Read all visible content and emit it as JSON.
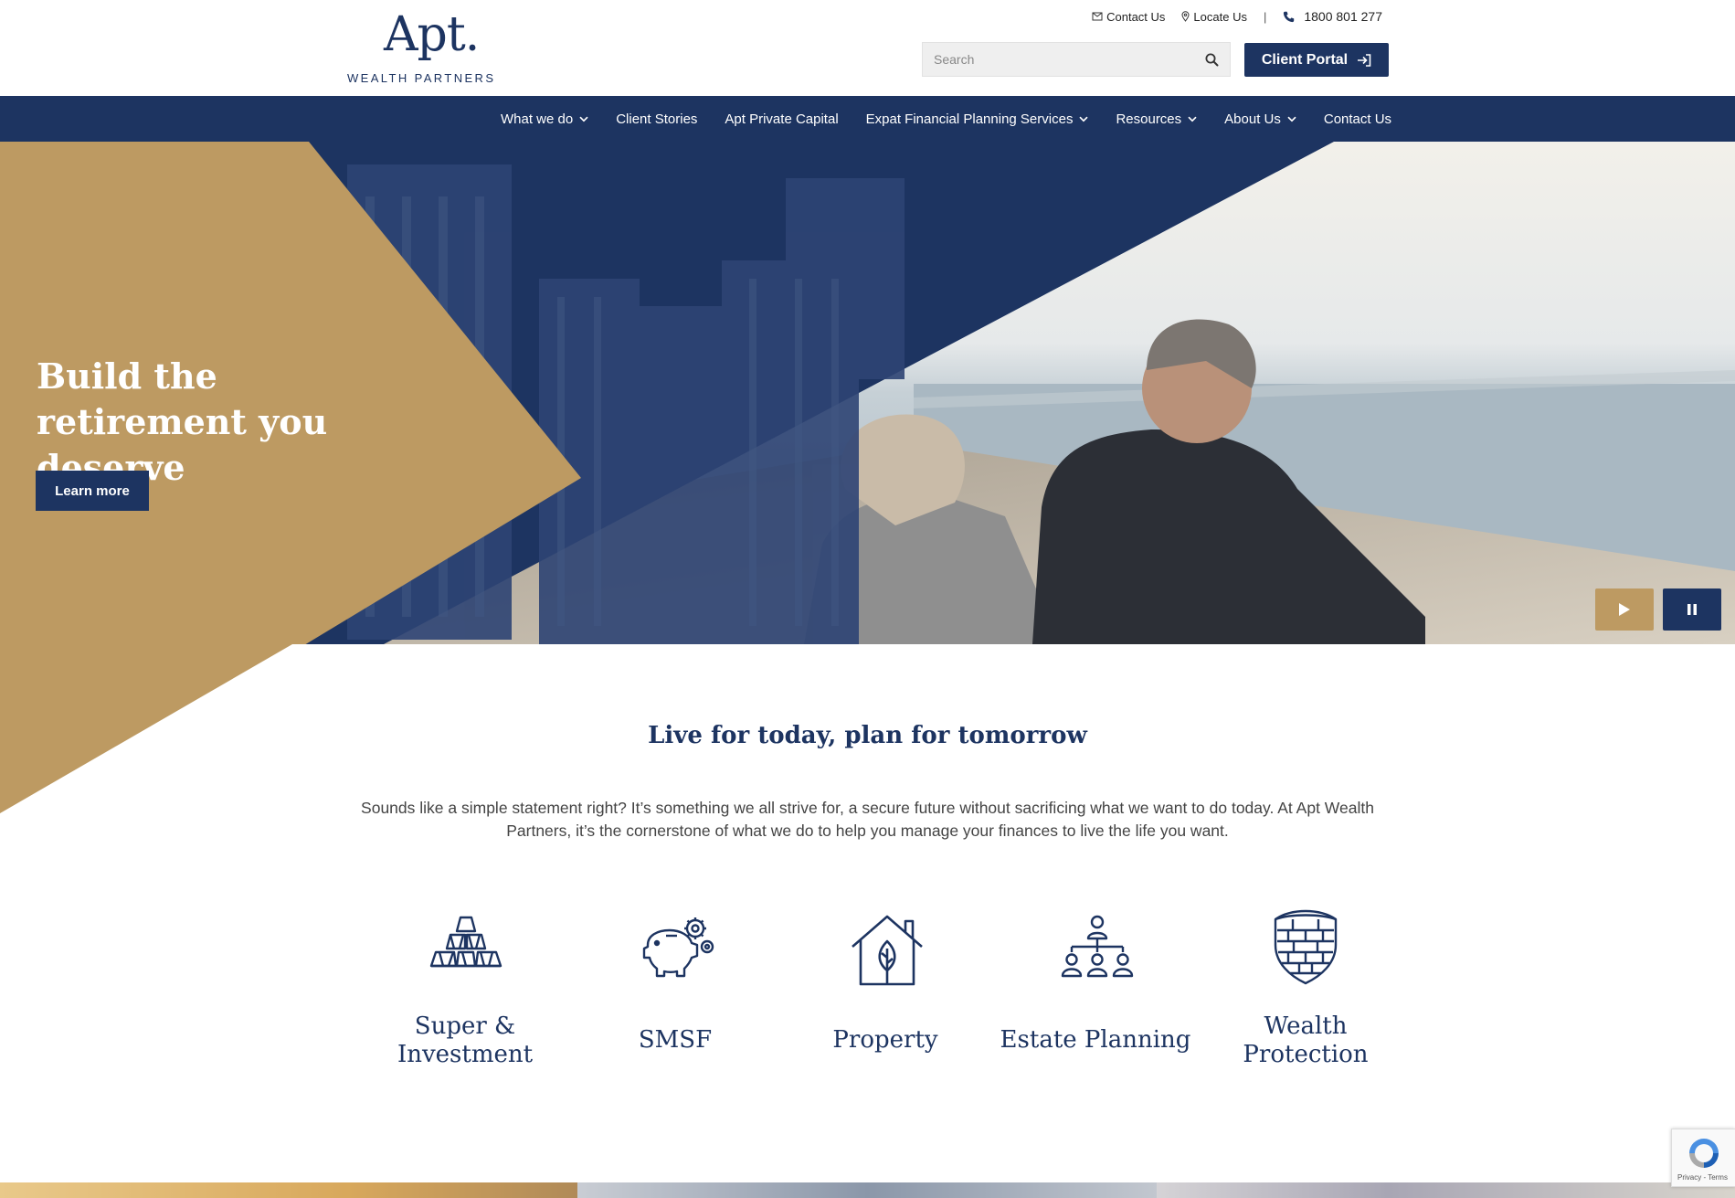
{
  "brand": {
    "logo_main": "Apt.",
    "logo_sub": "WEALTH PARTNERS",
    "navy": "#1d3461",
    "gold": "#bd9a62"
  },
  "top_links": {
    "contact": "Contact Us",
    "locate": "Locate Us",
    "separator": "|",
    "phone": "1800 801 277"
  },
  "search": {
    "placeholder": "Search"
  },
  "client_portal": {
    "label": "Client Portal"
  },
  "nav": {
    "items": [
      {
        "label": "What we do",
        "dropdown": true
      },
      {
        "label": "Client Stories",
        "dropdown": false
      },
      {
        "label": "Apt Private Capital",
        "dropdown": false
      },
      {
        "label": "Expat Financial Planning Services",
        "dropdown": true
      },
      {
        "label": "Resources",
        "dropdown": true
      },
      {
        "label": "About Us",
        "dropdown": true
      },
      {
        "label": "Contact Us",
        "dropdown": false
      }
    ]
  },
  "hero": {
    "title": "Build the retirement you deserve",
    "cta": "Learn more",
    "controls": {
      "play_icon": "play-icon",
      "pause_icon": "pause-icon"
    }
  },
  "intro": {
    "title": "Live for today, plan for tomorrow",
    "text": "Sounds like a simple statement right? It’s something we all strive for, a secure future without sacrificing what we want to do today. At Apt Wealth Partners, it’s the cornerstone of what we do to help you manage your finances to live the life you want."
  },
  "services": {
    "items": [
      {
        "label_line1": "Super &",
        "label_line2": "Investment",
        "icon": "gold-bars-icon"
      },
      {
        "label_line1": "SMSF",
        "label_line2": "",
        "icon": "piggy-bank-icon"
      },
      {
        "label_line1": "Property",
        "label_line2": "",
        "icon": "house-leaf-icon"
      },
      {
        "label_line1": "Estate Planning",
        "label_line2": "",
        "icon": "family-tree-icon"
      },
      {
        "label_line1": "Wealth",
        "label_line2": "Protection",
        "icon": "shield-icon"
      }
    ]
  },
  "recaptcha": {
    "text": "Privacy - Terms"
  }
}
